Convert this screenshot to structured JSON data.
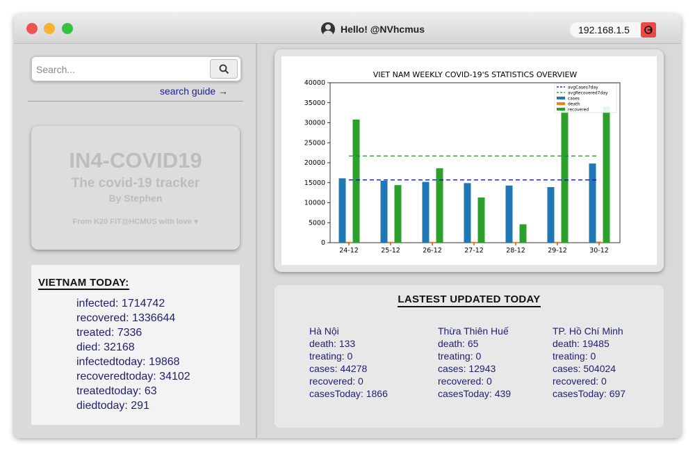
{
  "titlebar": {
    "greeting": "Hello! @NVhcmus",
    "ip": "192.168.1.5",
    "icons": {
      "avatar": "user-avatar-icon",
      "logout": "logout-icon"
    }
  },
  "search": {
    "placeholder": "Search...",
    "value": "",
    "guide_label": "search guide →"
  },
  "brand": {
    "title": "IN4-COVID19",
    "subtitle": "The covid-19 tracker",
    "author": "By Stephen",
    "credit": "From K20 FIT@HCMUS with love ♥"
  },
  "vietnam_today": {
    "title": "VIETNAM TODAY:",
    "items": [
      "infected: 1714742",
      "recovered: 1336644",
      "treated: 7336",
      "died: 32168",
      "infectedtoday: 19868",
      "recoveredtoday: 34102",
      "treatedtoday: 63",
      "diedtoday: 291"
    ]
  },
  "chart_data": {
    "type": "bar",
    "title": "VIET NAM WEEKLY COVID-19'S STATISTICS OVERVIEW",
    "categories": [
      "24-12",
      "25-12",
      "26-12",
      "27-12",
      "28-12",
      "29-12",
      "30-12"
    ],
    "series": [
      {
        "name": "cases",
        "color": "#1f77b4",
        "values": [
          16100,
          15500,
          15200,
          14900,
          14300,
          13900,
          19800
        ]
      },
      {
        "name": "death",
        "color": "#ff7f0e",
        "values": [
          250,
          240,
          230,
          220,
          215,
          240,
          291
        ]
      },
      {
        "name": "recovered",
        "color": "#2ca02c",
        "values": [
          30800,
          14400,
          18600,
          11300,
          4600,
          34000,
          34100
        ]
      }
    ],
    "lines": [
      {
        "name": "avgCases7day",
        "color": "#0000aa",
        "value": 15700
      },
      {
        "name": "avgRecovered7day",
        "color": "#228b22",
        "value": 21700
      }
    ],
    "yticks": [
      0,
      5000,
      10000,
      15000,
      20000,
      25000,
      30000,
      35000,
      40000
    ],
    "ylim": [
      0,
      40000
    ],
    "legend_position": "top-right",
    "grid": false
  },
  "latest": {
    "title": "LASTEST UPDATED TODAY",
    "cities": [
      {
        "name": "Hà Nội",
        "death": "death: 133",
        "treating": "treating: 0",
        "cases": "cases: 44278",
        "recovered": "recovered: 0",
        "casesToday": "casesToday: 1866"
      },
      {
        "name": "Thừa Thiên Huế",
        "death": "death: 65",
        "treating": "treating: 0",
        "cases": "cases: 12943",
        "recovered": "recovered: 0",
        "casesToday": "casesToday: 439"
      },
      {
        "name": "TP. Hồ Chí Minh",
        "death": "death: 19485",
        "treating": "treating: 0",
        "cases": "cases: 504024",
        "recovered": "recovered: 0",
        "casesToday": "casesToday: 697"
      }
    ]
  }
}
